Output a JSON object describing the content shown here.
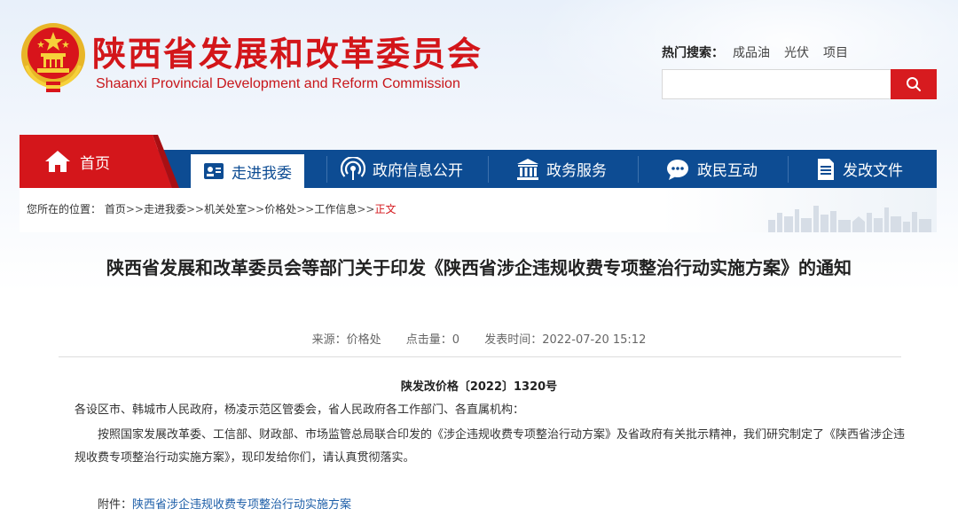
{
  "site": {
    "title_cn": "陕西省发展和改革委员会",
    "title_en": "Shaanxi Provincial Development and Reform Commission",
    "brand_red": "#d4161b",
    "nav_blue": "#0d4c93"
  },
  "search": {
    "hot_label": "热门搜索：",
    "hot_terms": [
      "成品油",
      "光伏",
      "项目"
    ],
    "value": "",
    "button_icon": "search-icon"
  },
  "nav": {
    "home": {
      "label": "首页",
      "icon": "home-icon"
    },
    "items": [
      {
        "label": "走进我委",
        "icon": "id-card-icon",
        "active": true
      },
      {
        "label": "政府信息公开",
        "icon": "broadcast-icon",
        "active": false
      },
      {
        "label": "政务服务",
        "icon": "government-building-icon",
        "active": false
      },
      {
        "label": "政民互动",
        "icon": "chat-bubble-icon",
        "active": false
      },
      {
        "label": "发改文件",
        "icon": "document-icon",
        "active": false
      }
    ]
  },
  "breadcrumb": {
    "prefix": "您所在的位置：",
    "items": [
      "首页",
      "走进我委",
      "机关处室",
      "价格处",
      "工作信息"
    ],
    "separator": ">>",
    "current": "正文"
  },
  "article": {
    "title": "陕西省发展和改革委员会等部门关于印发《陕西省涉企违规收费专项整治行动实施方案》的通知",
    "source": "来源：价格处",
    "views": "点击量：0",
    "published": "发表时间：2022-07-20 15:12",
    "doc_number": "陕发改价格〔2022〕1320号",
    "salutation": "各设区市、韩城市人民政府，杨凌示范区管委会，省人民政府各工作部门、各直属机构：",
    "body": "按照国家发展改革委、工信部、财政部、市场监管总局联合印发的《涉企违规收费专项整治行动方案》及省政府有关批示精神，我们研究制定了《陕西省涉企违规收费专项整治行动实施方案》，现印发给你们，请认真贯彻落实。",
    "attachment_label": "附件：",
    "attachment_link": "陕西省涉企违规收费专项整治行动实施方案"
  }
}
